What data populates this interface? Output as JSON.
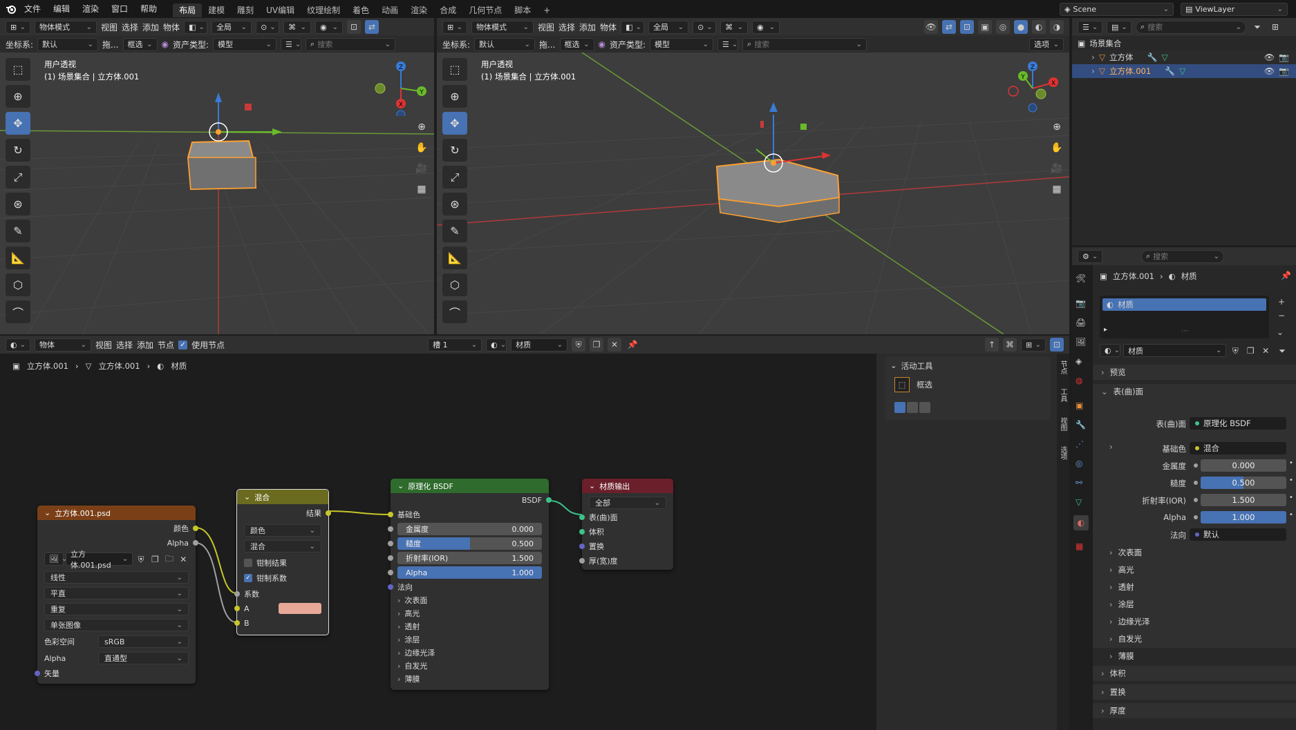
{
  "topbar": {
    "menus": [
      "文件",
      "编辑",
      "渲染",
      "窗口",
      "帮助"
    ],
    "workspaces": [
      "布局",
      "建模",
      "雕刻",
      "UV编辑",
      "纹理绘制",
      "着色",
      "动画",
      "渲染",
      "合成",
      "几何节点",
      "脚本"
    ],
    "active_workspace": "布局",
    "scene": "Scene",
    "view_layer": "ViewLayer"
  },
  "viewport_left": {
    "mode": "物体模式",
    "menus": [
      "视图",
      "选择",
      "添加",
      "物体"
    ],
    "orientation": "全局",
    "coord_label": "坐标系:",
    "coord_value": "默认",
    "drag_label": "拖...",
    "select_mode": "框选",
    "asset_type_label": "资产类型:",
    "asset_type": "模型",
    "search_placeholder": "搜索",
    "view_name": "用户透视",
    "collection_info": "(1) 场景集合 | 立方体.001"
  },
  "viewport_right": {
    "mode": "物体模式",
    "menus": [
      "视图",
      "选择",
      "添加",
      "物体"
    ],
    "orientation": "全局",
    "coord_label": "坐标系:",
    "coord_value": "默认",
    "drag_label": "拖...",
    "select_mode": "框选",
    "asset_type_label": "资产类型:",
    "asset_type": "模型",
    "search_placeholder": "搜索",
    "options": "选项",
    "view_name": "用户透视",
    "collection_info": "(1) 场景集合 | 立方体.001"
  },
  "outliner": {
    "search_placeholder": "搜索",
    "root": "场景集合",
    "items": [
      "立方体",
      "立方体.001"
    ]
  },
  "node_editor": {
    "type": "物体",
    "menus": [
      "视图",
      "选择",
      "添加",
      "节点"
    ],
    "use_nodes": "使用节点",
    "slot": "槽 1",
    "material": "材质",
    "breadcrumb": [
      "立方体.001",
      "立方体.001",
      "材质"
    ],
    "active_tool_title": "活动工具",
    "active_tool_name": "框选",
    "side_tabs": [
      "节点",
      "工具",
      "视图",
      "选项"
    ],
    "image_node": {
      "title": "立方体.001.psd",
      "out_color": "颜色",
      "out_alpha": "Alpha",
      "image_name": "立方体.001.psd",
      "interpolation": "线性",
      "projection": "平直",
      "extension": "重复",
      "source": "单张图像",
      "colorspace_label": "色彩空间",
      "colorspace": "sRGB",
      "alpha_label": "Alpha",
      "alpha_mode": "直通型",
      "in_vector": "矢量"
    },
    "mix_node": {
      "title": "混合",
      "out_result": "结果",
      "data_type": "颜色",
      "blend_mode": "混合",
      "clamp_result": "钳制结果",
      "clamp_factor": "钳制系数",
      "in_factor": "系数",
      "in_a": "A",
      "in_b": "B",
      "color_a": "#e8a898"
    },
    "bsdf_node": {
      "title": "原理化 BSDF",
      "out_bsdf": "BSDF",
      "base_color": "基础色",
      "metallic_label": "金属度",
      "metallic": "0.000",
      "roughness_label": "糙度",
      "roughness": "0.500",
      "ior_label": "折射率(IOR)",
      "ior": "1.500",
      "alpha_label": "Alpha",
      "alpha": "1.000",
      "normal": "法向",
      "panels": [
        "次表面",
        "高光",
        "透射",
        "涂层",
        "边缘光泽",
        "自发光",
        "薄膜"
      ]
    },
    "output_node": {
      "title": "材质输出",
      "target": "全部",
      "inputs": [
        "表(曲)面",
        "体积",
        "置换",
        "厚(宽)度"
      ]
    }
  },
  "properties": {
    "search_placeholder": "搜索",
    "breadcrumb_object": "立方体.001",
    "breadcrumb_tab": "材质",
    "slot_name": "材质",
    "material_name": "材质",
    "preview": "预览",
    "surface_section": "表(曲)面",
    "surface_label": "表(曲)面",
    "surface_value": "原理化 BSDF",
    "base_color_label": "基础色",
    "base_color_value": "混合",
    "metallic_label": "金属度",
    "metallic": "0.000",
    "roughness_label": "糙度",
    "roughness": "0.500",
    "ior_label": "折射率(IOR)",
    "ior": "1.500",
    "alpha_label": "Alpha",
    "alpha": "1.000",
    "normal_label": "法向",
    "normal_value": "默认",
    "subpanels": [
      "次表面",
      "高光",
      "透射",
      "涂层",
      "边缘光泽",
      "自发光",
      "薄膜"
    ],
    "sections": [
      "体积",
      "置换",
      "厚度"
    ]
  },
  "colors": {
    "accent": "#4772b3",
    "selection_orange": "#ffa030",
    "image_node_header": "#7a3f17",
    "mix_node_header": "#6b6b1f",
    "bsdf_node_header": "#2e6b2c",
    "output_node_header": "#6a1f2a"
  }
}
